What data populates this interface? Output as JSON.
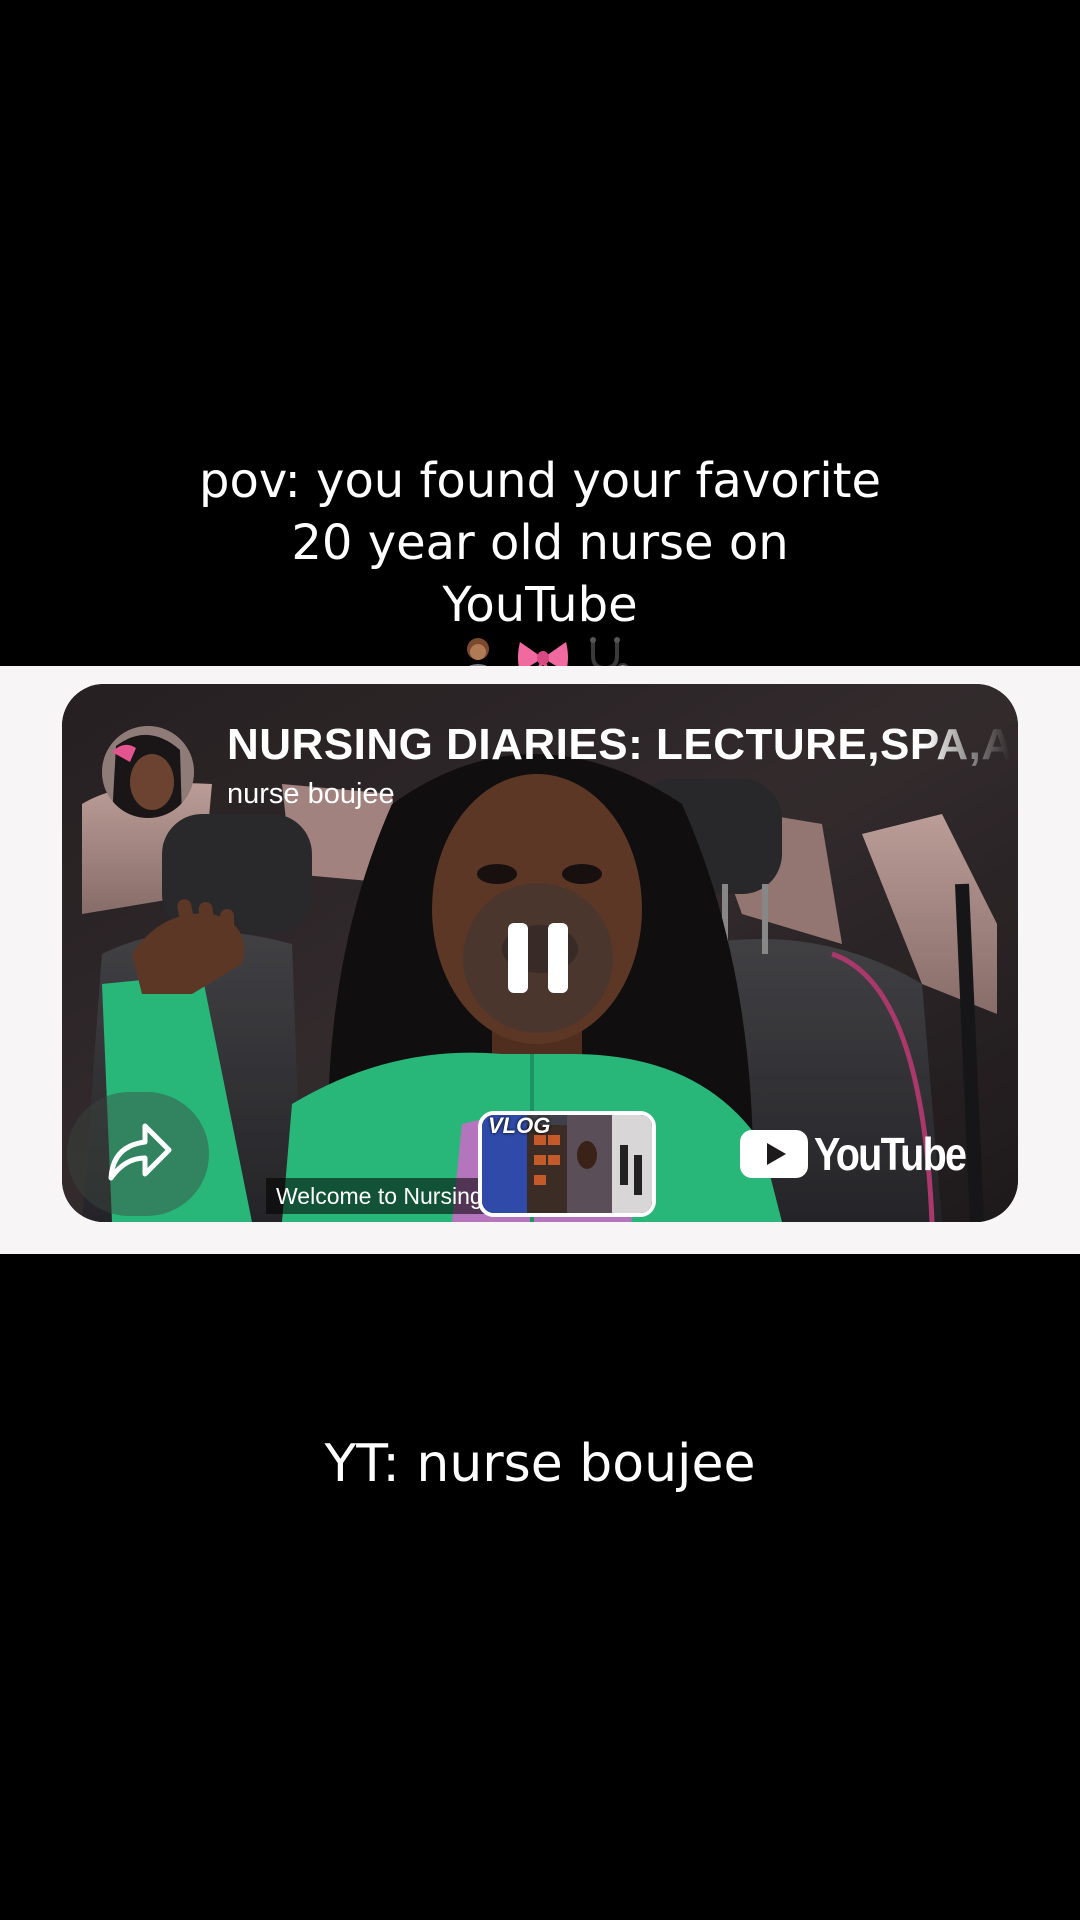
{
  "overlay_caption": {
    "lines": [
      "pov: you found your favorite",
      "20 year old nurse on",
      "YouTube"
    ],
    "emojis": [
      "technologist-emoji",
      "ribbon-emoji",
      "stethoscope-emoji"
    ]
  },
  "video_card": {
    "title": "NURSING DIARIES: LECTURE,SPA,A",
    "channel": "nurse boujee",
    "subtitle_caption": "Welcome to Nursing",
    "suggested_video_label": "VLOG",
    "brand_wordmark": "YouTube",
    "state": "playing",
    "icons": {
      "pause": "pause-icon",
      "share": "share-arrow-icon",
      "play": "youtube-play-icon"
    }
  },
  "bottom_caption": "YT: nurse boujee",
  "colors": {
    "background": "#000000",
    "band": "#f7f5f6",
    "jacket_green": "#2fd08a",
    "youtube_white": "#ffffff"
  }
}
